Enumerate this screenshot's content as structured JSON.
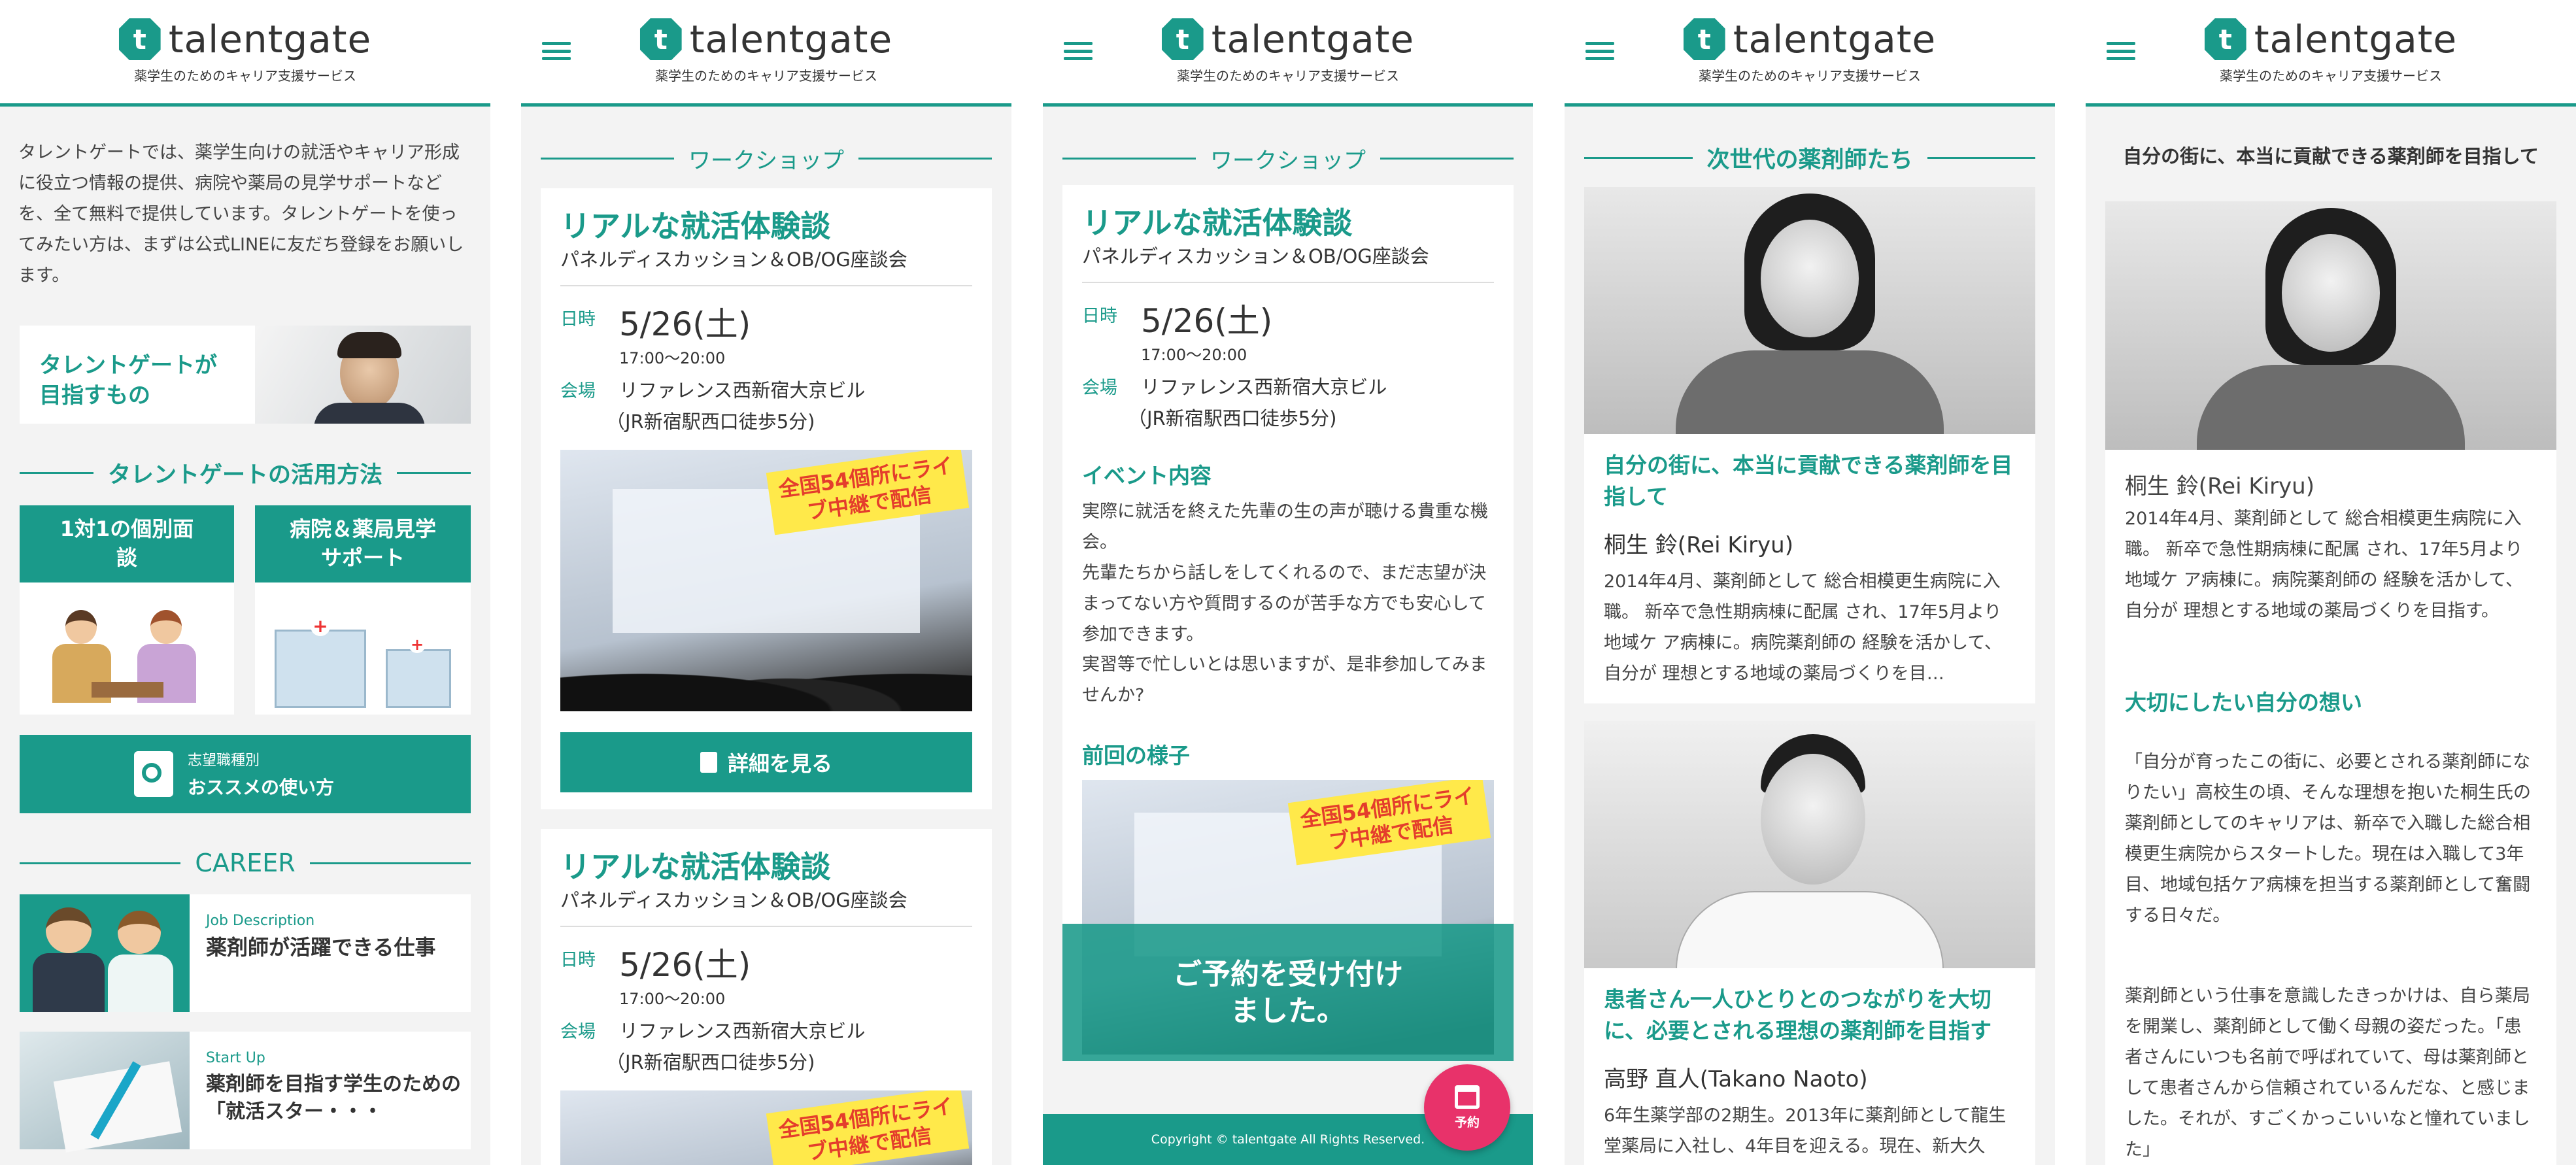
{
  "brand": {
    "name": "talentgate",
    "tagline": "薬学生のためのキャリア支援サービス",
    "mark": "t",
    "accent": "#1a9a8a"
  },
  "screen1": {
    "intro": "タレントゲートでは、薬学生向けの就活やキャリア形成に役立つ情報の提供、病院や薬局の見学サポートなどを、全て無料で提供しています。タレントゲートを使ってみたい方は、まずは公式LINEに友だち登録をお願いします。",
    "goal_banner": "タレントゲートが目指すもの",
    "usage_title": "タレントゲートの活用方法",
    "usage_cards": [
      {
        "title": "1対1の個別面談"
      },
      {
        "title": "病院＆薬局見学サポート"
      }
    ],
    "recommend": {
      "small": "志望職種別",
      "big": "おススメの使い方"
    },
    "career_title": "CAREER",
    "articles": [
      {
        "category": "Job Description",
        "title": "薬剤師が活躍できる仕事"
      },
      {
        "category": "Start Up",
        "title": "薬剤師を目指す学生のための「就活スター・・・"
      }
    ]
  },
  "workshop": {
    "section_title": "ワークショップ",
    "title": "リアルな就活体験談",
    "subtitle": "パネルディスカッション＆OB/OG座談会",
    "date_label": "日時",
    "date": "5/26(土)",
    "time": "17:00〜20:00",
    "venue_label": "会場",
    "venue": "リファレンス西新宿大京ビル",
    "venue_note": "（JR新宿駅西口徒歩5分)",
    "sticker": "全国54個所にライブ中継で配信",
    "detail_button": "詳細を見る"
  },
  "screen3": {
    "event_heading": "イベント内容",
    "event_text_1": "実際に就活を終えた先輩の生の声が聴ける貴重な機会。",
    "event_text_2": "先輩たちから話しをしてくれるので、まだ志望が決まってない方や質問するのが苦手な方でも安心して参加できます。",
    "event_text_3": "実習等で忙しいとは思いますが、是非参加してみませんか?",
    "prev_heading": "前回の様子",
    "overlay": "ご予約を受け付けました。",
    "copyright": "Copyright © talentgate All Rights Reserved.",
    "reserve_label": "予約"
  },
  "screen4": {
    "section_title": "次世代の薬剤師たち",
    "people": [
      {
        "headline": "自分の街に、本当に貢献できる薬剤師を目指して",
        "name": "桐生 鈴(Rei Kiryu)",
        "text": "2014年4月、薬剤師として 総合相模更生病院に入職。 新卒で急性期病棟に配属 され、17年5月より地域ケ ア病棟に。病院薬剤師の 経験を活かして、自分が 理想とする地域の薬局づくりを目…"
      },
      {
        "headline": "患者さん一人ひとりとのつながりを大切に、必要とされる理想の薬剤師を目指す",
        "name": "高野 直人(Takano Naoto)",
        "text": "6年生薬学部の2期生。2013年に薬剤師として龍生堂薬局に入社し、4年目を迎える。現在、新大久"
      }
    ]
  },
  "screen5": {
    "top_title": "自分の街に、本当に貢献できる薬剤師を目指して",
    "name": "桐生 鈴(Rei Kiryu)",
    "bio": "2014年4月、薬剤師として 総合相模更生病院に入職。 新卒で急性期病棟に配属 され、17年5月より地域ケ ア病棟に。病院薬剤師の 経験を活かして、自分が 理想とする地域の薬局づくりを目指す。",
    "heading": "大切にしたい自分の想い",
    "para1": "「自分が育ったこの街に、必要とされる薬剤師になりたい」高校生の頃、そんな理想を抱いた桐生氏の薬剤師としてのキャリアは、新卒で入職した総合相模更生病院からスタートした。現在は入職して3年目、地域包括ケア病棟を担当する薬剤師として奮闘する日々だ。",
    "para2": "薬剤師という仕事を意識したきっかけは、自ら薬局を開業し、薬剤師として働く母親の姿だった。「患者さんにいつも名前で呼ばれていて、母は薬剤師として患者さんから信頼されているんだな、と感じました。それが、すごくかっこいいなと憧れていました」"
  }
}
